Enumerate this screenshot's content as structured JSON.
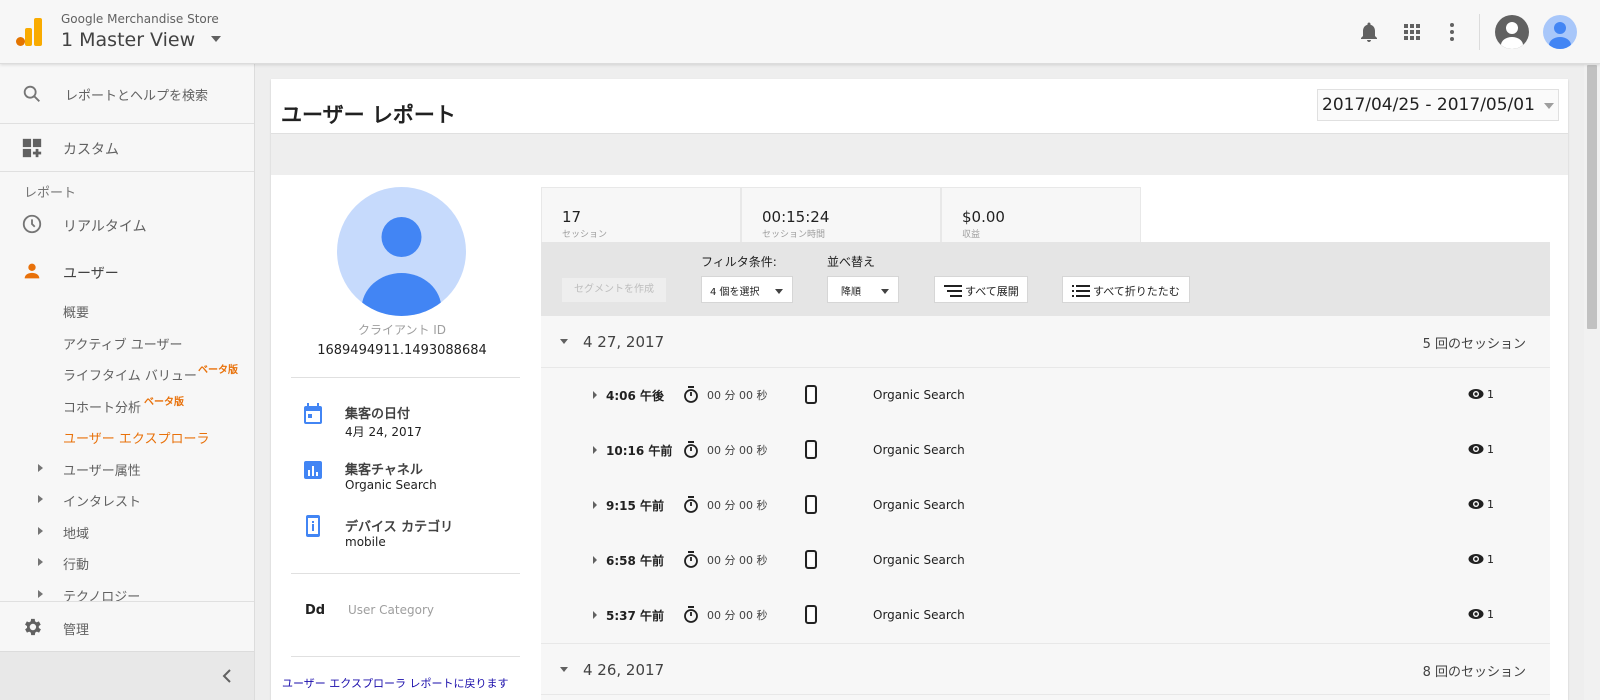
{
  "header": {
    "account_name": "Google Merchandise Store",
    "view_name": "1 Master View"
  },
  "sidebar": {
    "search_placeholder": "レポートとヘルプを検索",
    "custom_label": "カスタム",
    "section_label": "レポート",
    "realtime_label": "リアルタイム",
    "users_label": "ユーザー",
    "sub_items": [
      {
        "label": "概要"
      },
      {
        "label": "アクティブ ユーザー"
      },
      {
        "label": "ライフタイム バリュー",
        "badge": "ベータ版"
      },
      {
        "label": "コホート分析",
        "badge": "ベータ版"
      },
      {
        "label": "ユーザー エクスプローラ"
      }
    ],
    "groups": [
      {
        "label": "ユーザー属性"
      },
      {
        "label": "インタレスト"
      },
      {
        "label": "地域"
      },
      {
        "label": "行動"
      },
      {
        "label": "テクノロジー"
      }
    ],
    "admin_label": "管理"
  },
  "page": {
    "title": "ユーザー レポート",
    "date_range": "2017/04/25 - 2017/05/01"
  },
  "profile": {
    "client_id_label": "クライアント ID",
    "client_id": "1689494911.1493088684",
    "acquisition_date_title": "集客の日付",
    "acquisition_date_value": "4月 24, 2017",
    "channel_title": "集客チャネル",
    "channel_value": "Organic Search",
    "device_title": "デバイス カテゴリ",
    "device_value": "mobile",
    "dd_label": "Dd",
    "user_category": "User Category",
    "back_link": "ユーザー エクスプローラ レポートに戻ります"
  },
  "metrics": [
    {
      "value": "17",
      "label": "セッション"
    },
    {
      "value": "00:15:24",
      "label": "セッション時間"
    },
    {
      "value": "$0.00",
      "label": "収益"
    }
  ],
  "filters": {
    "create_segment": "セグメントを作成",
    "filter_label": "フィルタ条件:",
    "filter_value": "4 個を選択",
    "sort_label": "並べ替え",
    "sort_value": "降順",
    "expand_all": "すべて展開",
    "collapse_all": "すべて折りたたむ"
  },
  "days": [
    {
      "date": "4 27, 2017",
      "count": "5 回のセッション",
      "sessions": [
        {
          "time": "4:06 午後",
          "duration": "00 分 00 秒",
          "source": "Organic Search",
          "views": "1"
        },
        {
          "time": "10:16 午前",
          "duration": "00 分 00 秒",
          "source": "Organic Search",
          "views": "1"
        },
        {
          "time": "9:15 午前",
          "duration": "00 分 00 秒",
          "source": "Organic Search",
          "views": "1"
        },
        {
          "time": "6:58 午前",
          "duration": "00 分 00 秒",
          "source": "Organic Search",
          "views": "1"
        },
        {
          "time": "5:37 午前",
          "duration": "00 分 00 秒",
          "source": "Organic Search",
          "views": "1"
        }
      ]
    },
    {
      "date": "4 26, 2017",
      "count": "8 回のセッション"
    }
  ],
  "colors": {
    "accent_orange": "#e8710a",
    "icon_blue": "#4285f4",
    "link_blue": "#1a0dab"
  }
}
